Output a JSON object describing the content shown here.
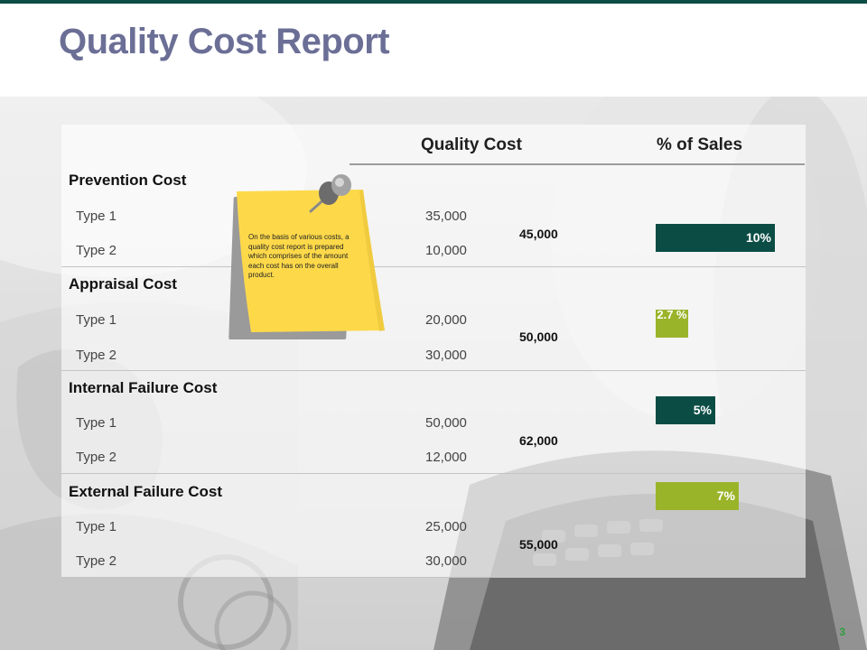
{
  "slide": {
    "title": "Quality Cost Report",
    "page_number": "3"
  },
  "table": {
    "headers": {
      "quality_cost": "Quality Cost",
      "percent_sales": "% of Sales"
    },
    "sections": [
      {
        "title": "Prevention Cost",
        "rows": [
          {
            "label": "Type 1",
            "value": "35,000"
          },
          {
            "label": "Type 2",
            "value": "10,000"
          }
        ],
        "total": "45,000",
        "percent": "10%",
        "percent_value": 10
      },
      {
        "title": "Appraisal Cost",
        "rows": [
          {
            "label": "Type 1",
            "value": "20,000"
          },
          {
            "label": "Type 2",
            "value": "30,000"
          }
        ],
        "total": "50,000",
        "percent": "2.7 %",
        "percent_value": 2.7
      },
      {
        "title": "Internal Failure Cost",
        "rows": [
          {
            "label": "Type 1",
            "value": "50,000"
          },
          {
            "label": "Type 2",
            "value": "12,000"
          }
        ],
        "total": "62,000",
        "percent": "5%",
        "percent_value": 5
      },
      {
        "title": "External Failure Cost",
        "rows": [
          {
            "label": "Type 1",
            "value": "25,000"
          },
          {
            "label": "Type 2",
            "value": "30,000"
          }
        ],
        "total": "55,000",
        "percent": "7%",
        "percent_value": 7
      }
    ]
  },
  "note": {
    "text": "On the basis of various costs, a quality cost report is prepared which comprises of the amount each cost has on the overall product."
  },
  "colors": {
    "accent_dark": "#0b4d45",
    "accent_green": "#9ab42a",
    "title_color": "#6b6f96",
    "note_yellow": "#fdd94a",
    "page_number": "#2f9e3f"
  },
  "icons": {
    "note_pin": "pushpin-icon"
  }
}
